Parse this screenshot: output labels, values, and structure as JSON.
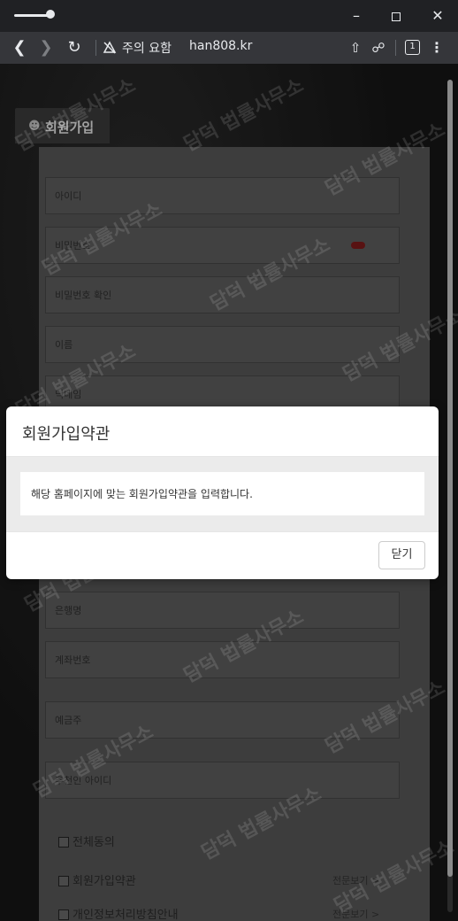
{
  "browser": {
    "security_warning": "주의 요함",
    "url": "han808.kr",
    "tab_count": "1",
    "icons": [
      "back-icon",
      "forward-icon",
      "reload-icon",
      "not-secure-icon",
      "share-icon",
      "extension-icon",
      "tabs-icon",
      "menu-icon",
      "minimize-icon",
      "maximize-icon",
      "close-icon"
    ]
  },
  "page": {
    "header_tab": "회원가입",
    "fields": [
      {
        "placeholder": "아이디"
      },
      {
        "placeholder": "비밀번호"
      },
      {
        "placeholder": "비밀번호 확인"
      },
      {
        "placeholder": "이름"
      },
      {
        "placeholder": "닉네임"
      },
      {
        "placeholder": "은행명"
      },
      {
        "placeholder": "계좌번호"
      },
      {
        "placeholder": "예금주"
      },
      {
        "placeholder": "추천인 아이디"
      }
    ],
    "agreements": {
      "all": "전체동의",
      "terms": "회원가입약관",
      "privacy": "개인정보처리방침안내",
      "view_all": "전문보기 >"
    }
  },
  "watermark": "담덕 법률사무소",
  "modal": {
    "title": "회원가입약관",
    "body": "해당 홈페이지에 맞는 회원가입약관을 입력합니다.",
    "close_label": "닫기"
  }
}
